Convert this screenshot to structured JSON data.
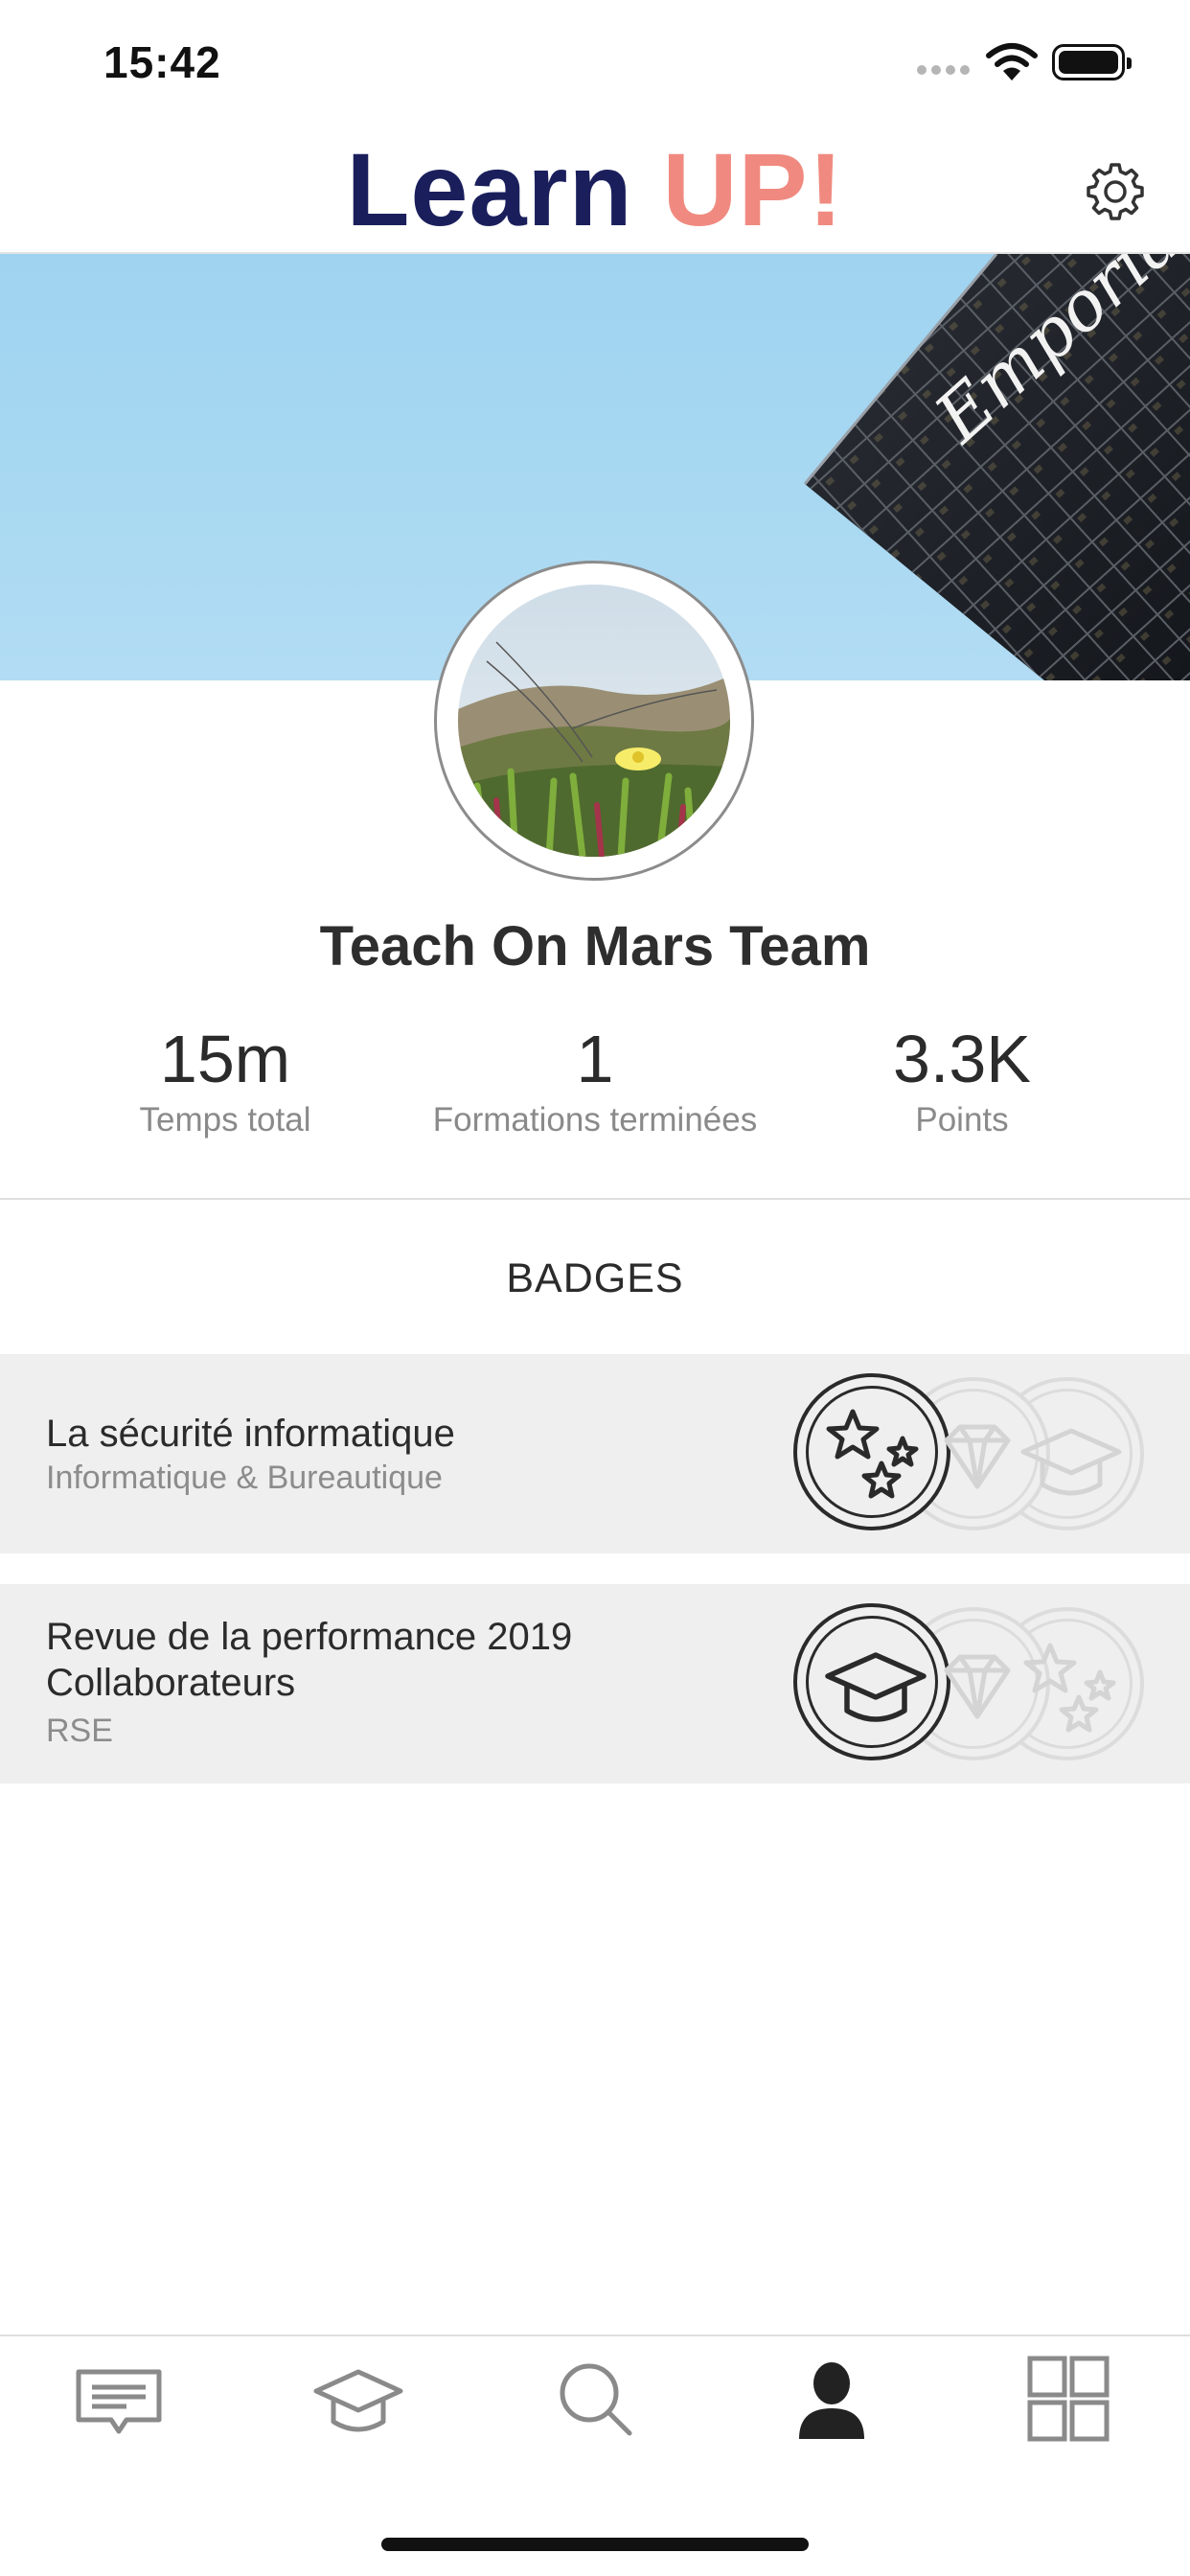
{
  "status_bar": {
    "time": "15:42"
  },
  "header": {
    "logo_part1": "Learn ",
    "logo_part2": "UP!"
  },
  "cover": {
    "building_sign": "Emporia"
  },
  "profile": {
    "name": "Teach On Mars Team"
  },
  "stats": [
    {
      "value": "15m",
      "label": "Temps total"
    },
    {
      "value": "1",
      "label": "Formations terminées"
    },
    {
      "value": "3.3K",
      "label": "Points"
    }
  ],
  "badges_section": {
    "title": "BADGES",
    "items": [
      {
        "title": "La sécurité informatique",
        "subtitle": "Informatique & Bureautique",
        "active_badge": "stars",
        "faded_badges": [
          "diamond",
          "graduation-cap"
        ]
      },
      {
        "title_line1": "Revue de la performance 2019",
        "title_line2": "Collaborateurs",
        "subtitle": "RSE",
        "active_badge": "graduation-cap",
        "faded_badges": [
          "diamond",
          "stars"
        ]
      }
    ]
  },
  "tab_bar": {
    "items": [
      "messages-icon",
      "courses-icon",
      "search-icon",
      "profile-icon",
      "apps-icon"
    ],
    "active": "profile-icon",
    "active_color": "#222222",
    "inactive_color": "#8a8a8a"
  },
  "colors": {
    "logo_dark": "#1a1f5c",
    "logo_accent": "#f08a80",
    "row_background": "#efefef"
  }
}
